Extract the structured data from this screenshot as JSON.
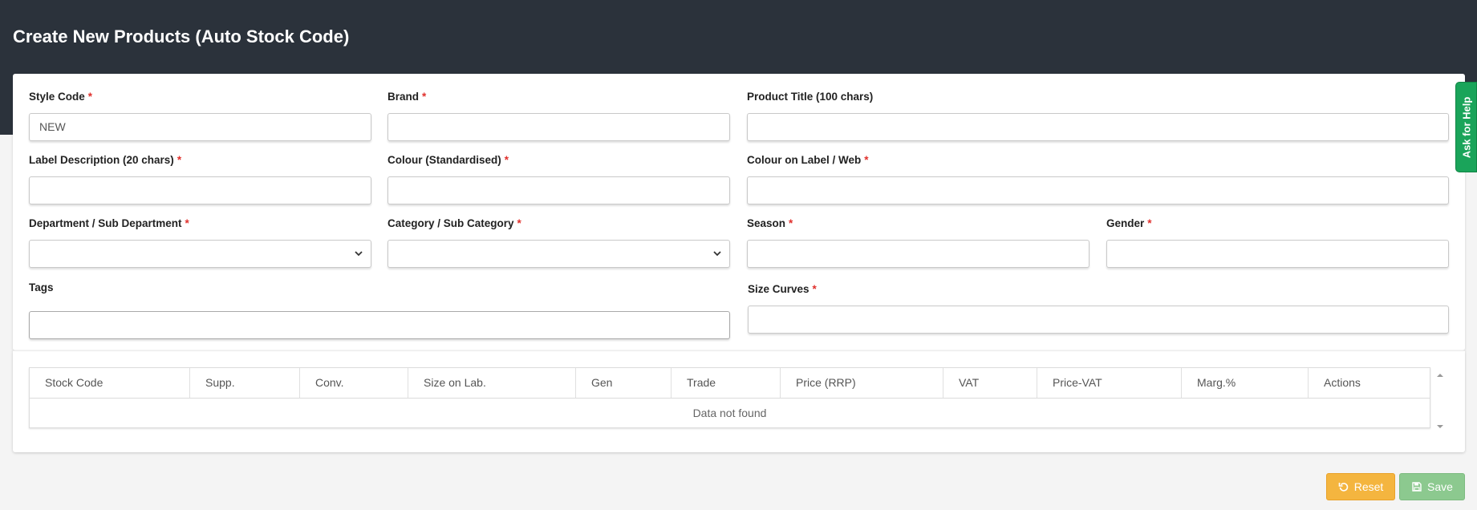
{
  "page": {
    "title": "Create New Products (Auto Stock Code)"
  },
  "form": {
    "style_code": {
      "label": "Style Code",
      "required": "*",
      "value": "NEW"
    },
    "brand": {
      "label": "Brand",
      "required": "*",
      "value": ""
    },
    "product_title": {
      "label": "Product Title (100 chars)",
      "value": ""
    },
    "label_description": {
      "label": "Label Description (20 chars)",
      "required": "*",
      "value": ""
    },
    "colour_standardised": {
      "label": "Colour (Standardised)",
      "required": "*",
      "value": ""
    },
    "colour_on_label": {
      "label": "Colour on Label / Web",
      "required": "*",
      "value": ""
    },
    "department": {
      "label": "Department / Sub Department",
      "required": "*",
      "value": ""
    },
    "category": {
      "label": "Category / Sub Category",
      "required": "*",
      "value": ""
    },
    "season": {
      "label": "Season",
      "required": "*",
      "value": ""
    },
    "gender": {
      "label": "Gender",
      "required": "*",
      "value": ""
    },
    "tags": {
      "label": "Tags",
      "value": ""
    },
    "size_curves": {
      "label": "Size Curves",
      "required": "*",
      "value": ""
    }
  },
  "table": {
    "columns": [
      "Stock Code",
      "Supp.",
      "Conv.",
      "Size on Lab.",
      "Gen",
      "Trade",
      "Price (RRP)",
      "VAT",
      "Price-VAT",
      "Marg.%",
      "Actions"
    ],
    "empty_message": "Data not found"
  },
  "help": {
    "label": "Ask for Help"
  },
  "actions": {
    "reset_label": "Reset",
    "save_label": "Save"
  },
  "colors": {
    "header_bg": "#2b323b",
    "reset": "#f4b53f",
    "save": "#8cc98f",
    "help": "#1aa45a",
    "required": "#e0302c"
  },
  "icons": {
    "reset": "undo-icon",
    "save": "floppy-disk-icon",
    "select": "chevron-down-icon"
  }
}
